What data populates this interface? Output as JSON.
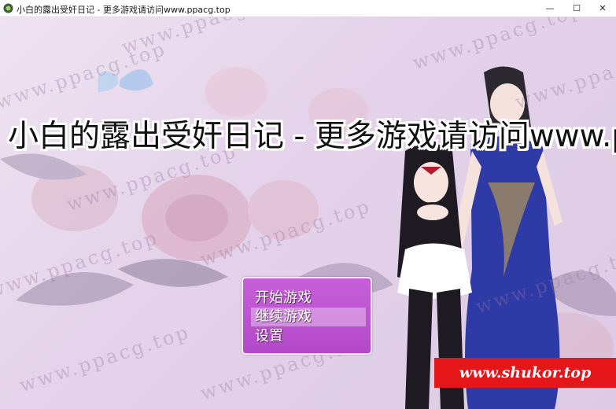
{
  "window": {
    "title": "小白的露出受奸日记 - 更多游戏请访问www.ppacg.top",
    "minimize_glyph": "—",
    "maximize_glyph": "☐",
    "close_glyph": "✕"
  },
  "game": {
    "title": "小白的露出受奸日记 - 更多游戏请访问www.ppacg.top",
    "watermark_text": "www.ppacg.top",
    "menu": {
      "items": [
        {
          "label": "开始游戏",
          "selected": false
        },
        {
          "label": "继续游戏",
          "selected": true
        },
        {
          "label": "设置",
          "selected": false
        }
      ]
    },
    "banner_text": "www.shukor.top"
  },
  "colors": {
    "menu_bg": "#c75fd9",
    "banner_bg": "#e4161a",
    "dress_blue": "#2e3aa6",
    "maid_black": "#1e1a22"
  },
  "icons": {
    "app": "app-icon"
  }
}
